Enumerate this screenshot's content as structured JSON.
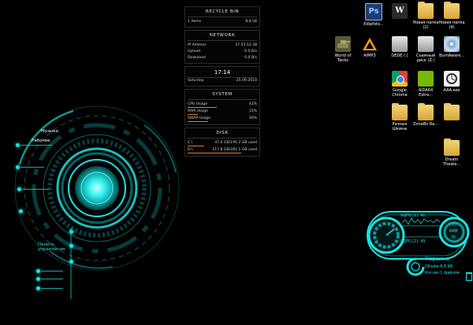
{
  "hud": {
    "labels": [
      "Музыка",
      "Рабочее",
      "Панель управления"
    ]
  },
  "monitor": {
    "recycle": {
      "title": "RECYCLE BIN",
      "items_label": "1 items",
      "items_size": "8.8 kB"
    },
    "network": {
      "title": "NETWORK",
      "rows": [
        {
          "label": "IP Address",
          "value": "37.55.51.38"
        },
        {
          "label": "Upload",
          "value": "0.0 B/s"
        },
        {
          "label": "Download",
          "value": "0.0 B/s"
        }
      ]
    },
    "clock": {
      "time": "17:14",
      "day": "Saturday",
      "date": "25.09.2010"
    },
    "system": {
      "title": "SYSTEM",
      "rows": [
        {
          "label": "CPU Usage",
          "value": "42%",
          "level": 0.42
        },
        {
          "label": "RAM Usage",
          "value": "15%",
          "level": 0.15
        },
        {
          "label": "SWAP Usage",
          "value": "30%",
          "level": 0.3
        }
      ]
    },
    "disk": {
      "title": "DISK",
      "rows": [
        {
          "label": "C:\\",
          "value": "47.6 GB/195.2 GB used",
          "level": 0.24
        },
        {
          "label": "D:\\",
          "value": "217.8 GB/281.1 GB used",
          "level": 0.77
        }
      ]
    }
  },
  "desktop": {
    "icons": [
      {
        "label": "Edipfoto...",
        "type": "ps"
      },
      {
        "label": "",
        "type": "pw"
      },
      {
        "label": "Новая папка (2)",
        "type": "folder"
      },
      {
        "label": "Новая папка (4)",
        "type": "folder"
      },
      {
        "label": "World of Tanks",
        "type": "tank"
      },
      {
        "label": "AIMP3",
        "type": "aimp"
      },
      {
        "label": "DEDE (:)",
        "type": "disk"
      },
      {
        "label": "Съемный диск (Z:)",
        "type": "disk"
      },
      {
        "label": "BurnAware...",
        "type": "dvd"
      },
      {
        "label": "Google Chrome",
        "type": "chrome"
      },
      {
        "label": "AIDA64 Extre...",
        "type": "eye"
      },
      {
        "label": "AAA.exe",
        "type": "doc"
      },
      {
        "label": "Разные Шкины",
        "type": "folder"
      },
      {
        "label": "ZonaBo Ra...",
        "type": "folder"
      },
      {
        "label": "",
        "type": "folder"
      },
      {
        "label": "Dream Theate...",
        "type": "folder"
      }
    ]
  },
  "widget": {
    "lines": [
      "ЯДРО [1]: 41",
      "ЯДРО [2]: 49",
      "CPU",
      "RAM",
      "35"
    ],
    "recycle_title": "Корзина",
    "recycle_size": "Объём:8.8 KB",
    "recycle_count": "Кол-во:1 файлов"
  },
  "colors": {
    "accent": "#19e3e3",
    "bar": "#e07a20"
  }
}
